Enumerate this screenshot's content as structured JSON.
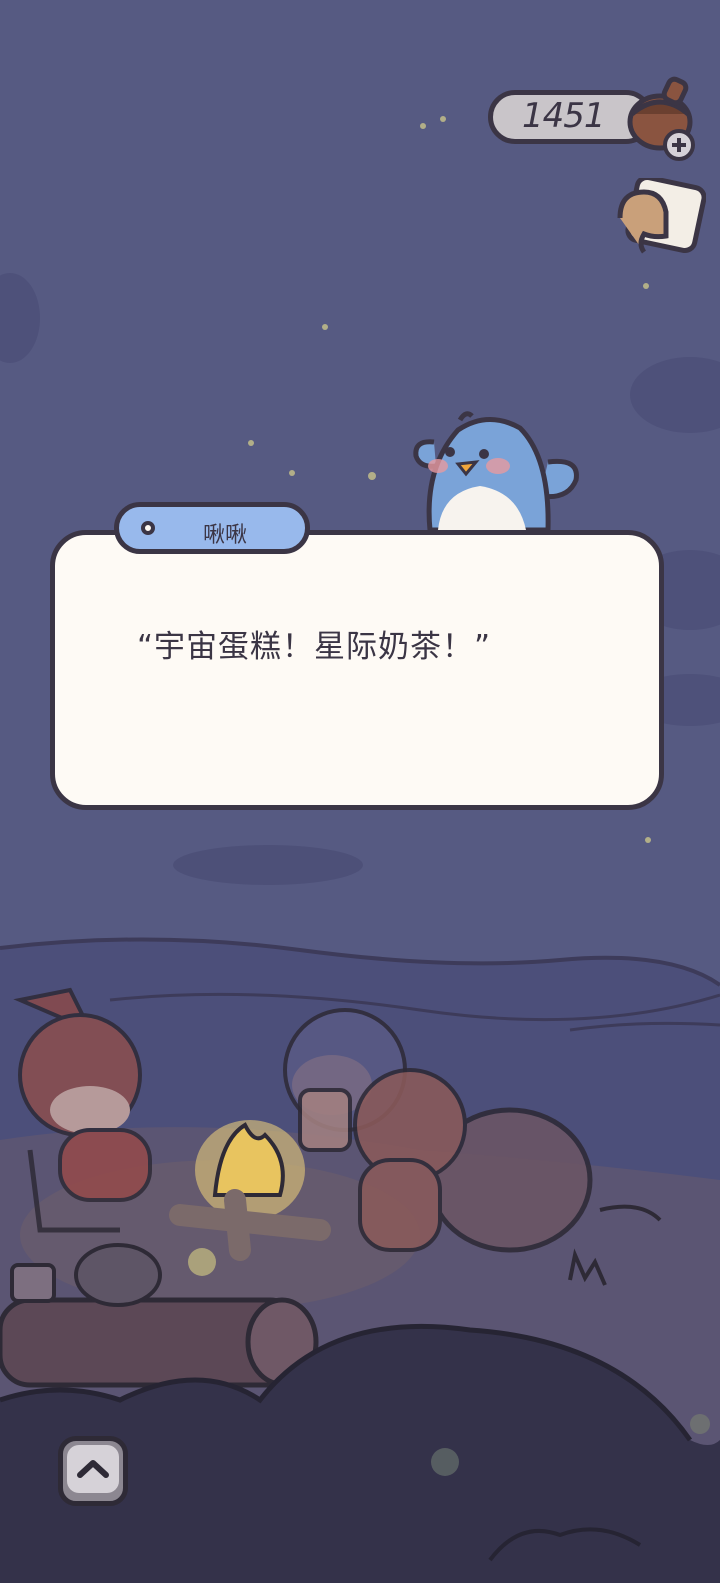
{
  "hud": {
    "acorn_count": "1451",
    "acorn_icon": "acorn-icon",
    "add_icon": "plus-icon",
    "gift_icon": "gift-card-icon"
  },
  "dialog": {
    "speaker_name": "啾啾",
    "text": "“宇宙蛋糕！星际奶茶！”"
  },
  "controls": {
    "expand_icon": "chevron-up-icon"
  },
  "colors": {
    "sky": "#565a82",
    "outline": "#3b3545",
    "dialog_bg": "#fefaf5",
    "name_tag": "#98b9ec"
  }
}
